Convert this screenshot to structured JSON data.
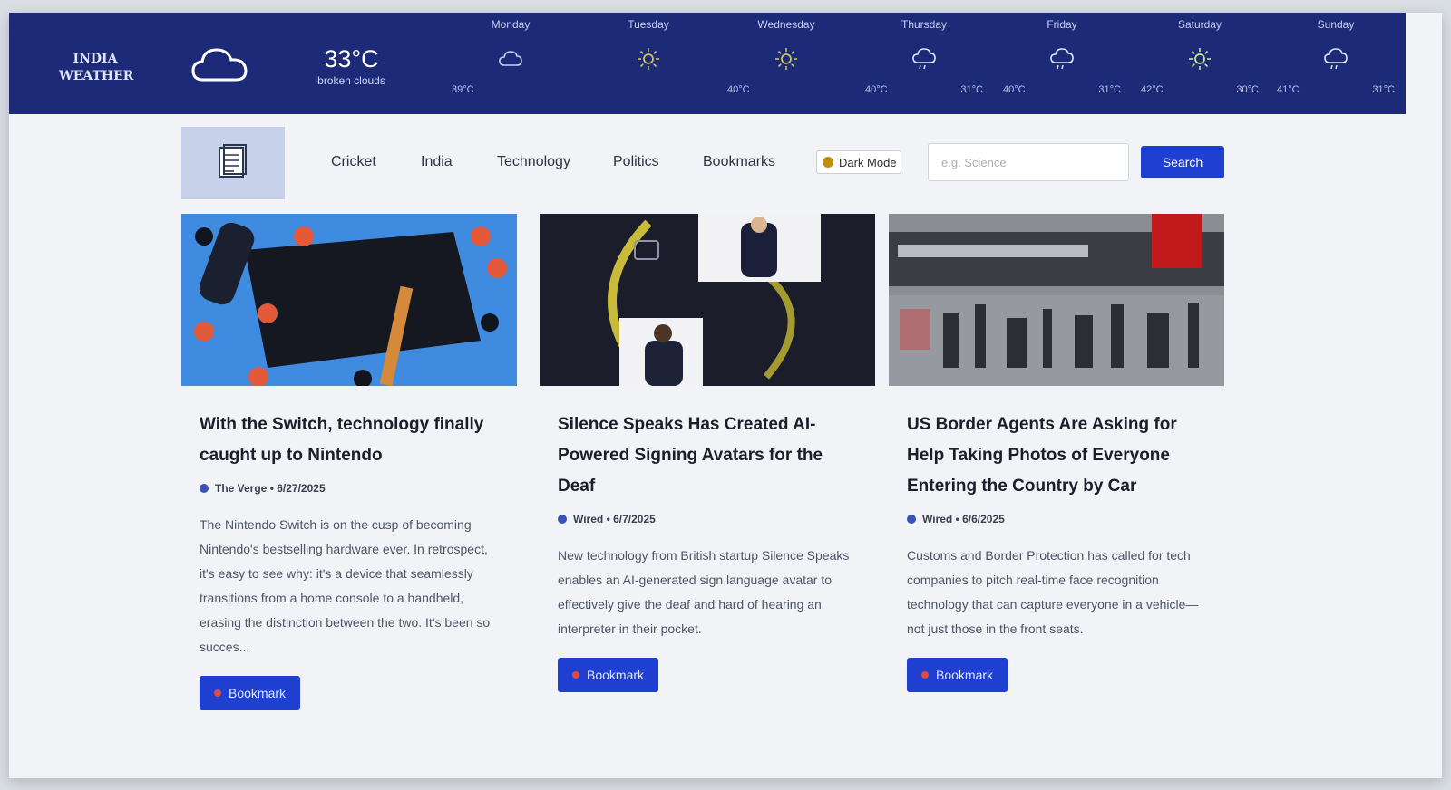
{
  "weather": {
    "brand_line1": "INDIA",
    "brand_line2": "WEATHER",
    "current_temp": "33°C",
    "current_desc": "broken clouds",
    "current_icon": "cloud-icon",
    "forecast": [
      {
        "day": "Monday",
        "icon": "cloud-icon",
        "low": "39°C",
        "high": ""
      },
      {
        "day": "Tuesday",
        "icon": "sun-icon",
        "low": "",
        "high": ""
      },
      {
        "day": "Wednesday",
        "icon": "sun-icon",
        "low": "40°C",
        "high": ""
      },
      {
        "day": "Thursday",
        "icon": "rain-cloud-icon",
        "low": "40°C",
        "high": "31°C"
      },
      {
        "day": "Friday",
        "icon": "rain-cloud-icon",
        "low": "40°C",
        "high": "31°C"
      },
      {
        "day": "Saturday",
        "icon": "sun-icon",
        "low": "42°C",
        "high": "30°C"
      },
      {
        "day": "Sunday",
        "icon": "rain-cloud-icon",
        "low": "41°C",
        "high": "31°C"
      }
    ]
  },
  "nav": {
    "links": [
      "Cricket",
      "India",
      "Technology",
      "Politics",
      "Bookmarks"
    ],
    "dark_mode_label": "Dark Mode",
    "search_placeholder": "e.g. Science",
    "search_button": "Search"
  },
  "articles": [
    {
      "title": "With the Switch, technology finally caught up to Nintendo",
      "source": "The Verge • 6/27/2025",
      "description": "The Nintendo Switch is on the cusp of becoming Nintendo's bestselling hardware ever. In retrospect, it's easy to see why: it's a device that seamlessly transitions from a home console to a handheld, erasing the distinction between the two. It's been so succes...",
      "bookmark_label": "Bookmark"
    },
    {
      "title": "Silence Speaks Has Created AI-Powered Signing Avatars for the Deaf",
      "source": "Wired • 6/7/2025",
      "description": "New technology from British startup Silence Speaks enables an AI-generated sign language avatar to effectively give the deaf and hard of hearing an interpreter in their pocket.",
      "bookmark_label": "Bookmark"
    },
    {
      "title": "US Border Agents Are Asking for Help Taking Photos of Everyone Entering the Country by Car",
      "source": "Wired • 6/6/2025",
      "description": "Customs and Border Protection has called for tech companies to pitch real-time face recognition technology that can capture everyone in a vehicle—not just those in the front seats.",
      "bookmark_label": "Bookmark"
    }
  ],
  "colors": {
    "weather_bar": "#1d2a78",
    "primary_button": "#1f3fd1",
    "logo_box": "#c7d2ea"
  }
}
